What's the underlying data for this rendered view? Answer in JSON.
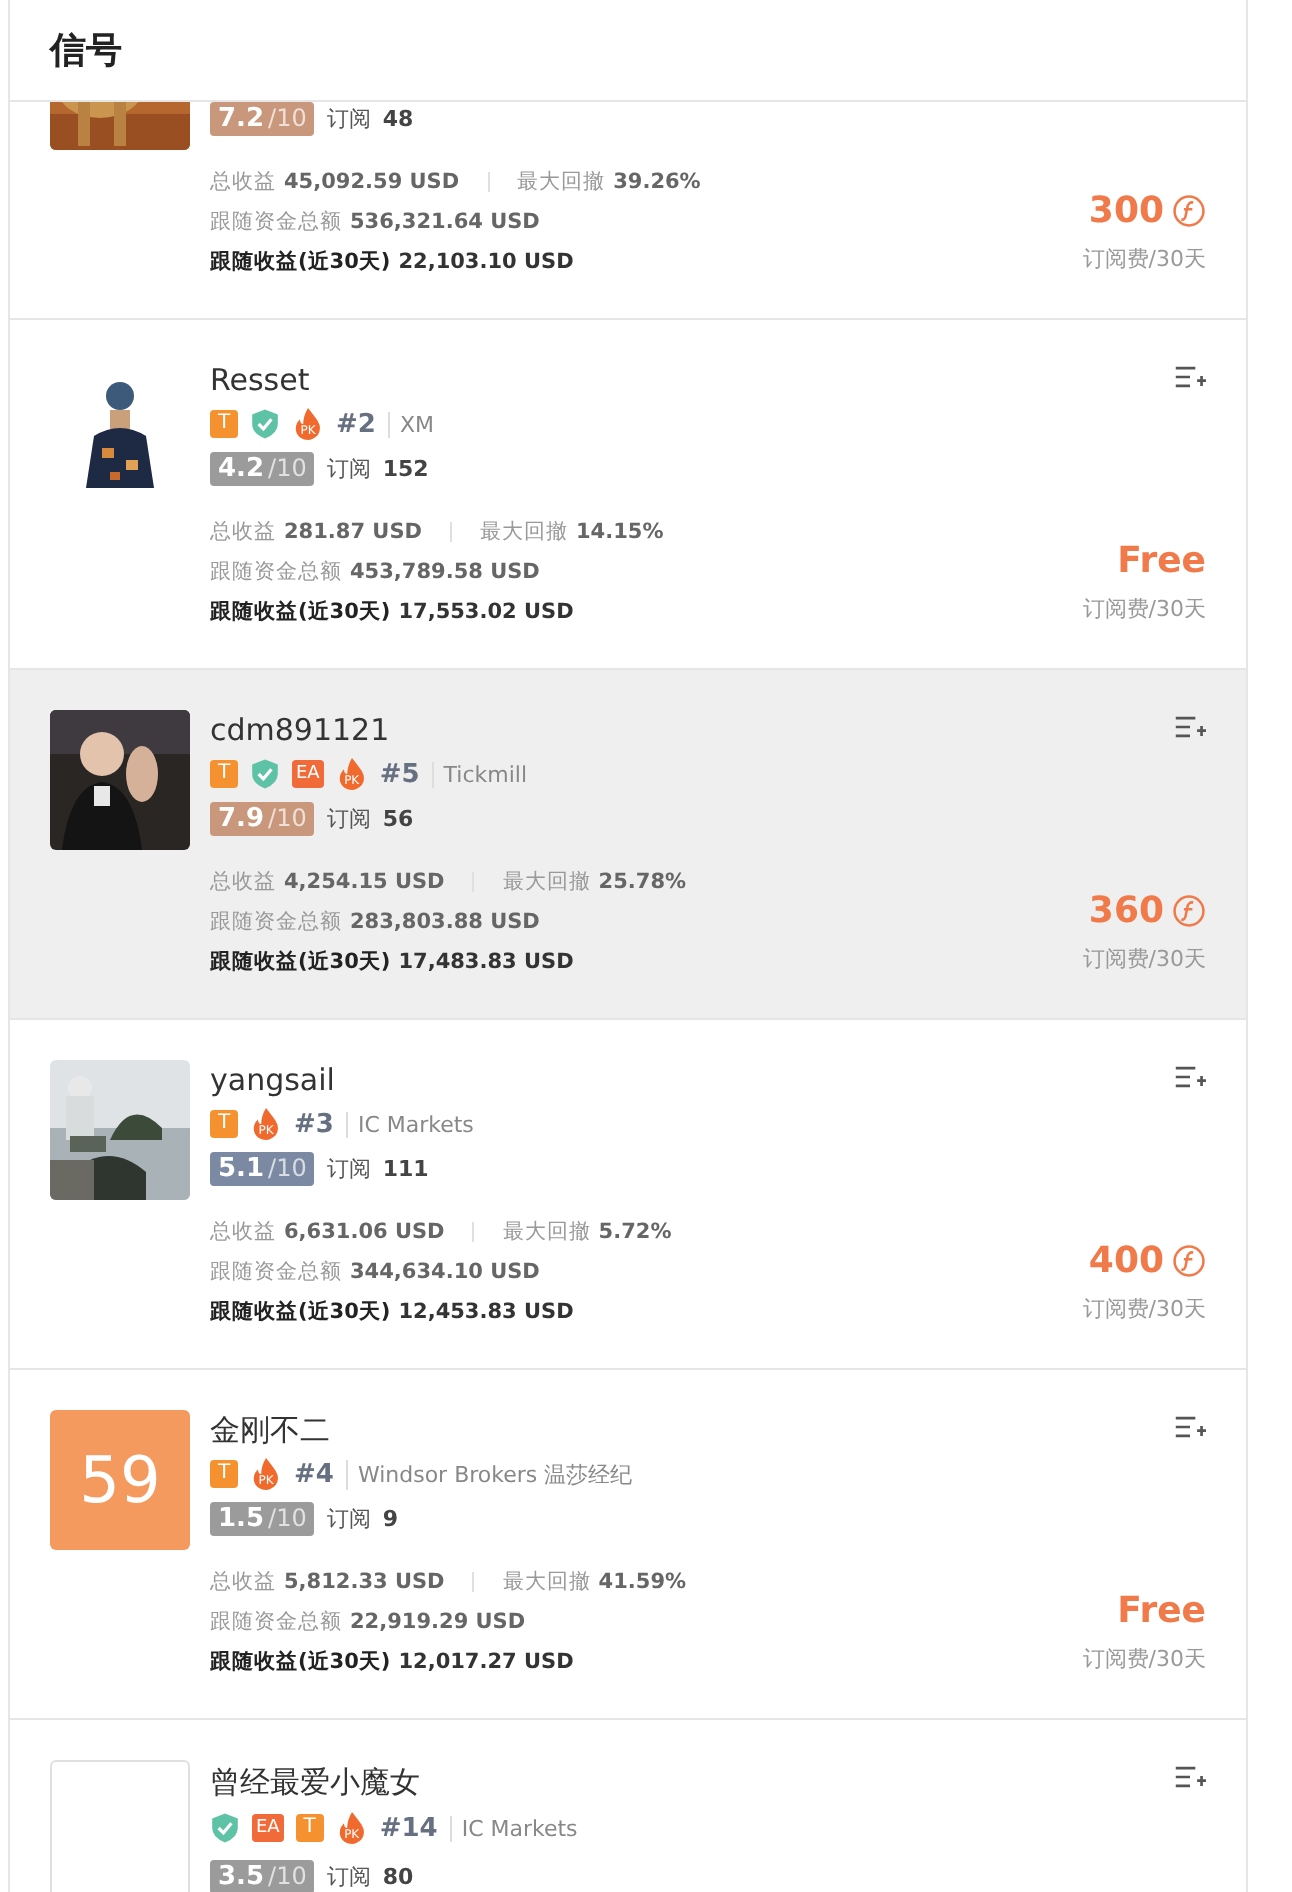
{
  "header": {
    "title": "信号"
  },
  "cards": [
    {
      "avatar": {
        "kind": "picture"
      },
      "highlighted": false,
      "score": "7.2",
      "score_max": "/10",
      "color": "#c9977b",
      "subs_label": "订阅",
      "subscribers": "48",
      "stats": [
        {
          "label": "总收益",
          "value": "45,092.59 USD"
        },
        {
          "label": "最大回撤",
          "value": "39.26%"
        },
        {
          "label": "跟随资金总额",
          "value": "536,321.64 USD"
        },
        {
          "label": "跟随收益(近30天)",
          "value": "22,103.10 USD"
        }
      ],
      "price": {
        "kind": "coin",
        "value": "300",
        "unit": "订阅费/30天"
      }
    },
    {
      "avatar": {
        "kind": "picture"
      },
      "highlighted": false,
      "name": "Resset",
      "badges": [
        {
          "kind": "t",
          "label": "T"
        },
        {
          "kind": "shield"
        },
        {
          "kind": "pk",
          "label": "PK"
        }
      ],
      "rank": "#2",
      "broker": "XM",
      "score": "4.2",
      "score_max": "/10",
      "color": "#9b9b9b",
      "subs_label": "订阅",
      "subscribers": "152",
      "stats": [
        {
          "label": "总收益",
          "value": "281.87 USD"
        },
        {
          "label": "最大回撤",
          "value": "14.15%"
        },
        {
          "label": "跟随资金总额",
          "value": "453,789.58 USD"
        },
        {
          "label": "跟随收益(近30天)",
          "value": "17,553.02 USD"
        }
      ],
      "price": {
        "kind": "free",
        "value": "Free",
        "unit": "订阅费/30天"
      }
    },
    {
      "avatar": {
        "kind": "picture"
      },
      "highlighted": true,
      "name": "cdm891121",
      "badges": [
        {
          "kind": "t",
          "label": "T"
        },
        {
          "kind": "shield"
        },
        {
          "kind": "ea",
          "label": "EA"
        },
        {
          "kind": "pk",
          "label": "PK"
        }
      ],
      "rank": "#5",
      "broker": "Tickmill",
      "score": "7.9",
      "score_max": "/10",
      "color": "#c9977b",
      "subs_label": "订阅",
      "subscribers": "56",
      "stats": [
        {
          "label": "总收益",
          "value": "4,254.15 USD"
        },
        {
          "label": "最大回撤",
          "value": "25.78%"
        },
        {
          "label": "跟随资金总额",
          "value": "283,803.88 USD"
        },
        {
          "label": "跟随收益(近30天)",
          "value": "17,483.83 USD"
        }
      ],
      "price": {
        "kind": "coin",
        "value": "360",
        "unit": "订阅费/30天"
      }
    },
    {
      "avatar": {
        "kind": "picture"
      },
      "highlighted": false,
      "name": "yangsail",
      "badges": [
        {
          "kind": "t",
          "label": "T"
        },
        {
          "kind": "pk",
          "label": "PK"
        }
      ],
      "rank": "#3",
      "broker": "IC Markets",
      "score": "5.1",
      "score_max": "/10",
      "color": "#7c89a3",
      "subs_label": "订阅",
      "subscribers": "111",
      "stats": [
        {
          "label": "总收益",
          "value": "6,631.06 USD"
        },
        {
          "label": "最大回撤",
          "value": "5.72%"
        },
        {
          "label": "跟随资金总额",
          "value": "344,634.10 USD"
        },
        {
          "label": "跟随收益(近30天)",
          "value": "12,453.83 USD"
        }
      ],
      "price": {
        "kind": "coin",
        "value": "400",
        "unit": "订阅费/30天"
      }
    },
    {
      "avatar": {
        "kind": "number",
        "text": "59"
      },
      "highlighted": false,
      "name": "金刚不二",
      "badges": [
        {
          "kind": "t",
          "label": "T"
        },
        {
          "kind": "pk",
          "label": "PK"
        }
      ],
      "rank": "#4",
      "broker": "Windsor Brokers 温莎经纪",
      "score": "1.5",
      "score_max": "/10",
      "color": "#9b9b9b",
      "subs_label": "订阅",
      "subscribers": "9",
      "stats": [
        {
          "label": "总收益",
          "value": "5,812.33 USD"
        },
        {
          "label": "最大回撤",
          "value": "41.59%"
        },
        {
          "label": "跟随资金总额",
          "value": "22,919.29 USD"
        },
        {
          "label": "跟随收益(近30天)",
          "value": "12,017.27 USD"
        }
      ],
      "price": {
        "kind": "free",
        "value": "Free",
        "unit": "订阅费/30天"
      }
    },
    {
      "avatar": {
        "kind": "blank"
      },
      "highlighted": false,
      "name": "曾经最爱小魔女",
      "badges": [
        {
          "kind": "shield"
        },
        {
          "kind": "ea",
          "label": "EA"
        },
        {
          "kind": "t",
          "label": "T"
        },
        {
          "kind": "pk",
          "label": "PK"
        }
      ],
      "rank": "#14",
      "broker": "IC Markets",
      "score": "3.5",
      "score_max": "/10",
      "color": "#9b9b9b",
      "subs_label": "订阅",
      "subscribers": "80"
    }
  ]
}
